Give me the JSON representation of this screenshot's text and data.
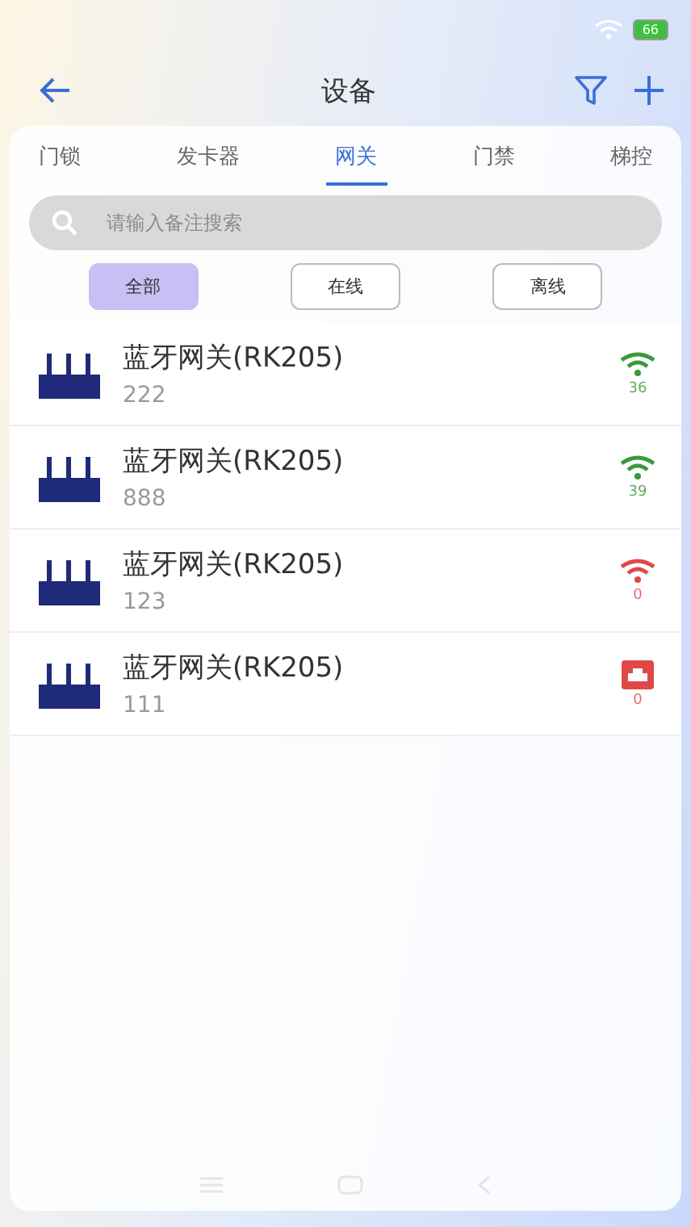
{
  "status_bar": {
    "battery": "66"
  },
  "header": {
    "title": "设备"
  },
  "tabs": [
    {
      "label": "门锁",
      "selected": false
    },
    {
      "label": "发卡器",
      "selected": false
    },
    {
      "label": "网关",
      "selected": true
    },
    {
      "label": "门禁",
      "selected": false
    },
    {
      "label": "梯控",
      "selected": false
    }
  ],
  "search": {
    "placeholder": "请输入备注搜索"
  },
  "filters": [
    {
      "label": "全部",
      "selected": true
    },
    {
      "label": "在线",
      "selected": false
    },
    {
      "label": "离线",
      "selected": false
    }
  ],
  "devices": [
    {
      "name": "蓝牙网关(RK205)",
      "note": "222",
      "kind": "wifi",
      "color": "#3a9a3a",
      "signal": "36"
    },
    {
      "name": "蓝牙网关(RK205)",
      "note": "888",
      "kind": "wifi",
      "color": "#3a9a3a",
      "signal": "39"
    },
    {
      "name": "蓝牙网关(RK205)",
      "note": "123",
      "kind": "wifi",
      "color": "#e04848",
      "signal": "0"
    },
    {
      "name": "蓝牙网关(RK205)",
      "note": "111",
      "kind": "wired",
      "color": "#e04848",
      "signal": "0"
    }
  ]
}
